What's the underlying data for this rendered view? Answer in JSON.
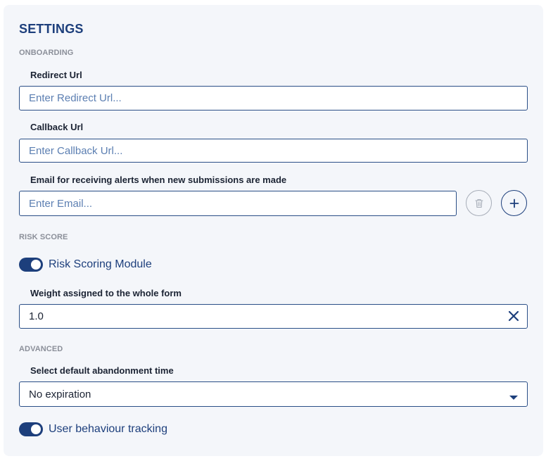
{
  "settings": {
    "title": "SETTINGS",
    "onboarding": {
      "section_label": "ONBOARDING",
      "redirect_url": {
        "label": "Redirect Url",
        "placeholder": "Enter Redirect Url...",
        "value": ""
      },
      "callback_url": {
        "label": "Callback Url",
        "placeholder": "Enter Callback Url...",
        "value": ""
      },
      "email": {
        "label": "Email for receiving alerts when new submissions are made",
        "placeholder": "Enter Email...",
        "value": ""
      }
    },
    "risk_score": {
      "section_label": "RISK SCORE",
      "module_toggle": {
        "label": "Risk Scoring Module",
        "on": true
      },
      "weight": {
        "label": "Weight assigned to the whole form",
        "value": "1.0"
      }
    },
    "advanced": {
      "section_label": "ADVANCED",
      "abandonment": {
        "label": "Select default abandonment time",
        "selected": "No expiration"
      },
      "tracking_toggle": {
        "label": "User behaviour tracking",
        "on": true
      }
    }
  },
  "colors": {
    "primary": "#1d3f7c",
    "panel_bg": "#f4f6fa",
    "section_text": "#8b8f99",
    "placeholder": "#5c7fb2"
  },
  "icons": {
    "delete": "trash-icon",
    "add": "plus-icon",
    "clear": "close-icon",
    "dropdown": "caret-down-icon"
  }
}
